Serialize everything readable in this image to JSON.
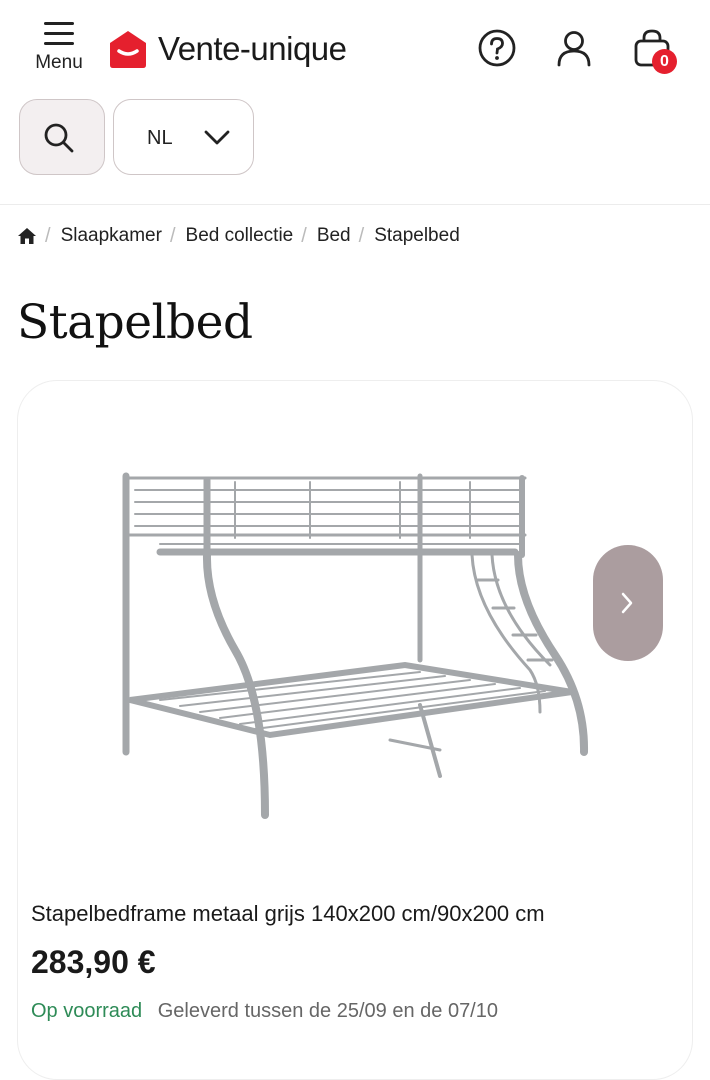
{
  "header": {
    "menu_label": "Menu",
    "logo_text": "Vente-unique",
    "cart_count": "0",
    "brand_color": "#e5202e",
    "icons": [
      "menu-icon",
      "help-icon",
      "account-icon",
      "cart-icon"
    ]
  },
  "toolbar": {
    "language": "NL"
  },
  "breadcrumb": {
    "items": [
      "Slaapkamer",
      "Bed collectie",
      "Bed",
      "Stapelbed"
    ]
  },
  "page": {
    "title": "Stapelbed"
  },
  "product": {
    "name": "Stapelbedframe metaal grijs 140x200 cm/90x200 cm",
    "price": "283,90 €",
    "stock": "Op voorraad",
    "delivery": "Geleverd tussen de 25/09 en de 07/10"
  }
}
